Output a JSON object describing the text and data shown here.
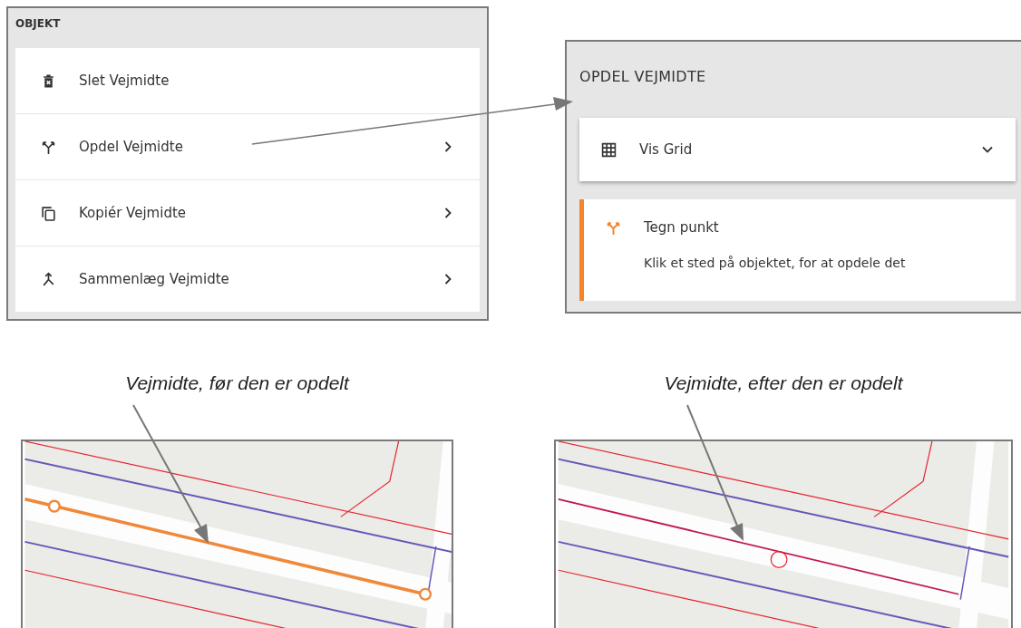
{
  "object_panel": {
    "title": "OBJEKT",
    "items": [
      {
        "label": "Slet Vejmidte",
        "kind": "delete",
        "submenu": false
      },
      {
        "label": "Opdel Vejmidte",
        "kind": "split",
        "submenu": true
      },
      {
        "label": "Kopiér Vejmidte",
        "kind": "copy",
        "submenu": true
      },
      {
        "label": "Sammenlæg Vejmidte",
        "kind": "merge",
        "submenu": true
      }
    ]
  },
  "split_panel": {
    "title": "OPDEL VEJMIDTE",
    "grid_option": {
      "label": "Vis Grid",
      "expanded": false
    },
    "tool": {
      "label": "Tegn punkt",
      "hint": "Klik et sted på objektet, for at opdele det",
      "active": true
    }
  },
  "maps": [
    {
      "caption": "Vejmidte, før den er opdelt",
      "kind": "before"
    },
    {
      "caption": "Vejmidte, efter den er opdelt",
      "kind": "after"
    }
  ]
}
